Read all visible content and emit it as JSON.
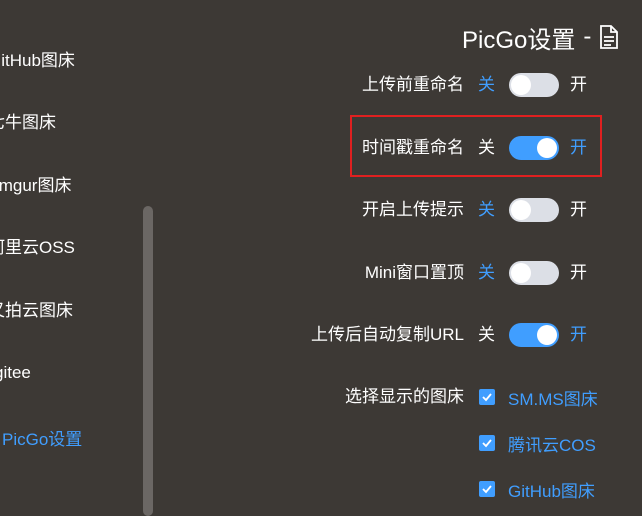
{
  "sidebar": {
    "items": [
      {
        "label": "GitHub图床"
      },
      {
        "label": "七牛图床"
      },
      {
        "label": "Imgur图床"
      },
      {
        "label": "阿里云OSS"
      },
      {
        "label": "又拍云图床"
      },
      {
        "label": "gitee"
      },
      {
        "label": "PicGo设置",
        "active": true
      }
    ]
  },
  "header": {
    "title": "PicGo设置",
    "separator": "-",
    "icon": "document-icon"
  },
  "settings": [
    {
      "label": "上传前重命名",
      "off": "关",
      "on": "开",
      "state": false
    },
    {
      "label": "时间戳重命名",
      "off": "关",
      "on": "开",
      "state": true
    },
    {
      "label": "开启上传提示",
      "off": "关",
      "on": "开",
      "state": false
    },
    {
      "label": "Mini窗口置顶",
      "off": "关",
      "on": "开",
      "state": false
    },
    {
      "label": "上传后自动复制URL",
      "off": "关",
      "on": "开",
      "state": true
    }
  ],
  "picbed_select": {
    "label": "选择显示的图床",
    "options": [
      {
        "label": "SM.MS图床",
        "checked": true
      },
      {
        "label": "腾讯云COS",
        "checked": true
      },
      {
        "label": "GitHub图床",
        "checked": true
      }
    ]
  },
  "colors": {
    "accent": "#409eff",
    "background": "#3d3935",
    "highlight_border": "#e02020",
    "switch_off": "#dcdfe6"
  }
}
